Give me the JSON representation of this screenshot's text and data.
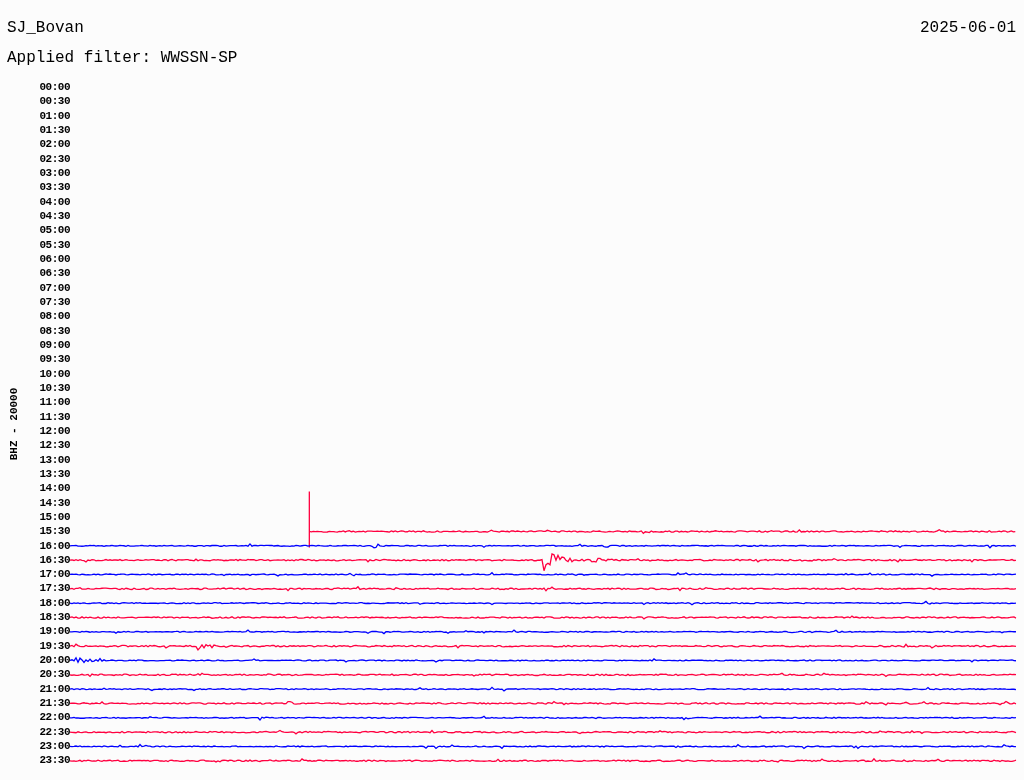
{
  "station": "SJ_Bovan",
  "date": "2025-06-01",
  "filter_label": "Applied filter: WWSSN-SP",
  "channel_label": "BHZ - 20000",
  "rows": [
    {
      "time": "00:00"
    },
    {
      "time": "00:30"
    },
    {
      "time": "01:00"
    },
    {
      "time": "01:30"
    },
    {
      "time": "02:00"
    },
    {
      "time": "02:30"
    },
    {
      "time": "03:00"
    },
    {
      "time": "03:30"
    },
    {
      "time": "04:00"
    },
    {
      "time": "04:30"
    },
    {
      "time": "05:00"
    },
    {
      "time": "05:30"
    },
    {
      "time": "06:00"
    },
    {
      "time": "06:30"
    },
    {
      "time": "07:00"
    },
    {
      "time": "07:30"
    },
    {
      "time": "08:00"
    },
    {
      "time": "08:30"
    },
    {
      "time": "09:00"
    },
    {
      "time": "09:30"
    },
    {
      "time": "10:00"
    },
    {
      "time": "10:30"
    },
    {
      "time": "11:00"
    },
    {
      "time": "11:30"
    },
    {
      "time": "12:00"
    },
    {
      "time": "12:30"
    },
    {
      "time": "13:00"
    },
    {
      "time": "13:30"
    },
    {
      "time": "14:00"
    },
    {
      "time": "14:30"
    },
    {
      "time": "15:00"
    },
    {
      "time": "15:30",
      "color": "#ff0040"
    },
    {
      "time": "16:00",
      "color": "#0000ff"
    },
    {
      "time": "16:30",
      "color": "#ff0040"
    },
    {
      "time": "17:00",
      "color": "#0000ff"
    },
    {
      "time": "17:30",
      "color": "#ff0040"
    },
    {
      "time": "18:00",
      "color": "#0000ff"
    },
    {
      "time": "18:30",
      "color": "#ff0040"
    },
    {
      "time": "19:00",
      "color": "#0000ff"
    },
    {
      "time": "19:30",
      "color": "#ff0040"
    },
    {
      "time": "20:00",
      "color": "#0000ff"
    },
    {
      "time": "20:30",
      "color": "#ff0040"
    },
    {
      "time": "21:00",
      "color": "#0000ff"
    },
    {
      "time": "21:30",
      "color": "#ff0040"
    },
    {
      "time": "22:00",
      "color": "#0000ff"
    },
    {
      "time": "22:30",
      "color": "#ff0040"
    },
    {
      "time": "23:00",
      "color": "#0000ff"
    },
    {
      "time": "23:30",
      "color": "#ff0040"
    }
  ]
}
